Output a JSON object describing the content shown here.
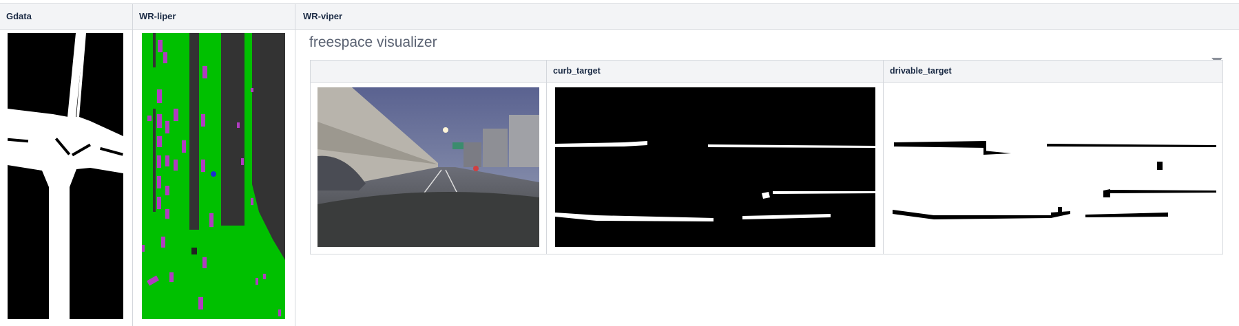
{
  "columns": {
    "gdata": "Gdata",
    "wr_liper": "WR-liper",
    "wr_viper": "WR-viper"
  },
  "viper": {
    "title": "freespace visualizer",
    "inner_columns": [
      "",
      "curb_target",
      "drivable_target"
    ]
  },
  "icons": {
    "filter": "filter-icon"
  },
  "colors": {
    "header_bg": "#f3f4f6",
    "border": "#d4d7dc",
    "green_field": "#00c000",
    "magenta": "#b03cc0",
    "dark_gray": "#333333"
  }
}
